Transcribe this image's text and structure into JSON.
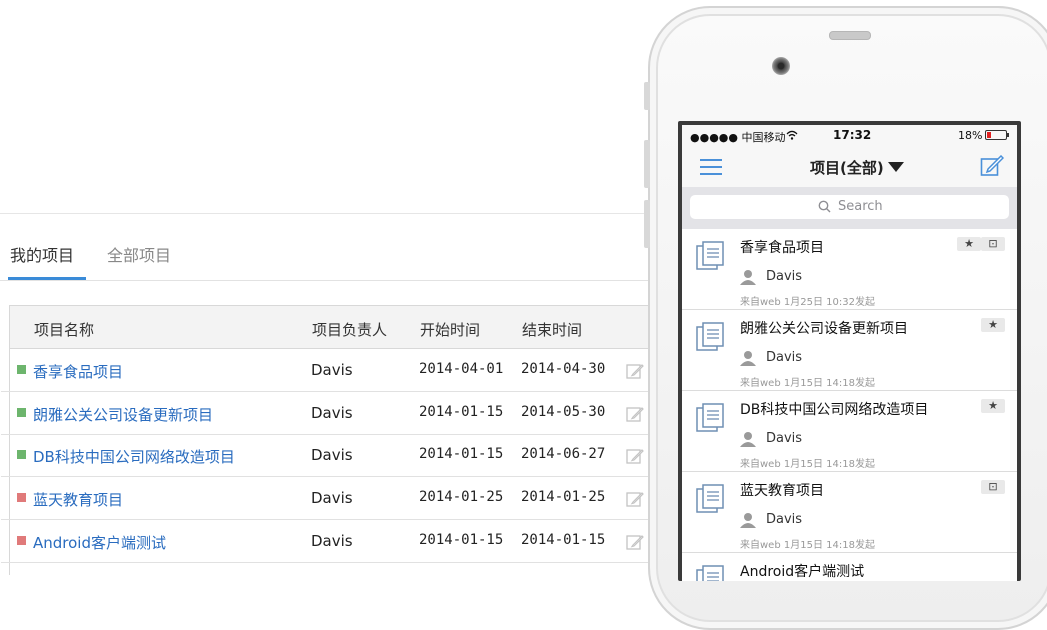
{
  "colors": {
    "accent": "#3a8bd8",
    "link": "#2a6cbf",
    "green": "#6db56d",
    "red": "#e07a7a"
  },
  "tabs": [
    {
      "label": "我的项目",
      "active": true
    },
    {
      "label": "全部项目",
      "active": false
    }
  ],
  "table": {
    "headers": {
      "name": "项目名称",
      "owner": "项目负责人",
      "start": "开始时间",
      "end": "结束时间"
    },
    "rows": [
      {
        "name": "香享食品项目",
        "owner": "Davis",
        "start": "2014-04-01",
        "end": "2014-04-30",
        "status": "green"
      },
      {
        "name": "朗雅公关公司设备更新项目",
        "owner": "Davis",
        "start": "2014-01-15",
        "end": "2014-05-30",
        "status": "green"
      },
      {
        "name": "DB科技中国公司网络改造项目",
        "owner": "Davis",
        "start": "2014-01-15",
        "end": "2014-06-27",
        "status": "green"
      },
      {
        "name": "蓝天教育项目",
        "owner": "Davis",
        "start": "2014-01-25",
        "end": "2014-01-25",
        "status": "red"
      },
      {
        "name": "Android客户端测试",
        "owner": "Davis",
        "start": "2014-01-15",
        "end": "2014-01-15",
        "status": "red"
      }
    ]
  },
  "phone": {
    "status": {
      "carrier": "●●●●● 中国移动",
      "time": "17:32",
      "battery": "18%"
    },
    "nav_title": "项目(全部)",
    "search_placeholder": "Search",
    "items": [
      {
        "title": "香享食品项目",
        "user": "Davis",
        "meta": "来自web  1月25日 10:32发起",
        "badges": [
          "★",
          "⊡"
        ]
      },
      {
        "title": "朗雅公关公司设备更新项目",
        "user": "Davis",
        "meta": "来自web  1月15日 14:18发起",
        "badges": [
          "★"
        ]
      },
      {
        "title": "DB科技中国公司网络改造项目",
        "user": "Davis",
        "meta": "来自web  1月15日 14:18发起",
        "badges": [
          "★"
        ]
      },
      {
        "title": "蓝天教育项目",
        "user": "Davis",
        "meta": "来自web  1月15日 14:18发起",
        "badges": [
          "⊡"
        ]
      },
      {
        "title": "Android客户端测试",
        "user": "",
        "meta": "",
        "badges": []
      }
    ]
  }
}
